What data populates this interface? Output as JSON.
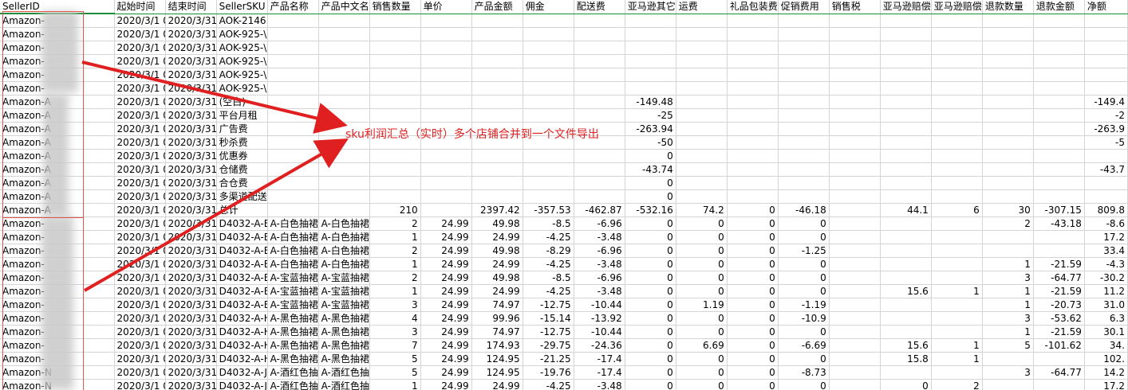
{
  "columns": [
    "SellerID",
    "起始时间",
    "结束时间",
    "SellerSKU",
    "产品名称",
    "产品中文名",
    "销售数量",
    "单价",
    "产品金额",
    "佣金",
    "配送费",
    "亚马逊其它",
    "运费",
    "礼品包装费",
    "促销费用",
    "销售税",
    "亚马逊赔偿",
    "亚马逊赔偿",
    "退款数量",
    "退款金额",
    "净额"
  ],
  "rows": [
    [
      "Amazon-",
      "2020/3/1 0",
      "2020/3/31",
      "AOK-2146",
      "",
      "",
      "",
      "",
      "",
      "",
      "",
      "",
      "",
      "",
      "",
      "",
      "",
      "",
      "",
      "",
      ""
    ],
    [
      "Amazon-",
      "2020/3/1 0",
      "2020/3/31",
      "AOK-925-\\",
      "",
      "",
      "",
      "",
      "",
      "",
      "",
      "",
      "",
      "",
      "",
      "",
      "",
      "",
      "",
      "",
      ""
    ],
    [
      "Amazon-",
      "2020/3/1 0",
      "2020/3/31",
      "AOK-925-\\",
      "",
      "",
      "",
      "",
      "",
      "",
      "",
      "",
      "",
      "",
      "",
      "",
      "",
      "",
      "",
      "",
      ""
    ],
    [
      "Amazon-",
      "2020/3/1 0",
      "2020/3/31",
      "AOK-925-\\",
      "",
      "",
      "",
      "",
      "",
      "",
      "",
      "",
      "",
      "",
      "",
      "",
      "",
      "",
      "",
      "",
      ""
    ],
    [
      "Amazon-",
      "2020/3/1 0",
      "2020/3/31",
      "AOK-925-\\",
      "",
      "",
      "",
      "",
      "",
      "",
      "",
      "",
      "",
      "",
      "",
      "",
      "",
      "",
      "",
      "",
      ""
    ],
    [
      "Amazon-",
      "2020/3/1 0",
      "2020/3/31",
      "AOK-925-\\",
      "",
      "",
      "",
      "",
      "",
      "",
      "",
      "",
      "",
      "",
      "",
      "",
      "",
      "",
      "",
      "",
      ""
    ],
    [
      "Amazon-A",
      "2020/3/1 0",
      "2020/3/31",
      "(空白)",
      "",
      "",
      "",
      "",
      "",
      "",
      "",
      "-149.48",
      "",
      "",
      "",
      "",
      "",
      "",
      "",
      "",
      "-149.4"
    ],
    [
      "Amazon-A",
      "2020/3/1 0",
      "2020/3/31",
      "平台月租",
      "",
      "",
      "",
      "",
      "",
      "",
      "",
      "-25",
      "",
      "",
      "",
      "",
      "",
      "",
      "",
      "",
      "-2"
    ],
    [
      "Amazon-A",
      "2020/3/1 0",
      "2020/3/31",
      "广告费",
      "",
      "",
      "",
      "",
      "",
      "",
      "",
      "-263.94",
      "",
      "",
      "",
      "",
      "",
      "",
      "",
      "",
      "-263.9"
    ],
    [
      "Amazon-A",
      "2020/3/1 0",
      "2020/3/31",
      "秒杀费",
      "",
      "",
      "",
      "",
      "",
      "",
      "",
      "-50",
      "",
      "",
      "",
      "",
      "",
      "",
      "",
      "",
      "-5"
    ],
    [
      "Amazon-A",
      "2020/3/1 0",
      "2020/3/31",
      "优惠券",
      "",
      "",
      "",
      "",
      "",
      "",
      "",
      "0",
      "",
      "",
      "",
      "",
      "",
      "",
      "",
      "",
      ""
    ],
    [
      "Amazon-A",
      "2020/3/1 0",
      "2020/3/31",
      "仓储费",
      "",
      "",
      "",
      "",
      "",
      "",
      "",
      "-43.74",
      "",
      "",
      "",
      "",
      "",
      "",
      "",
      "",
      "-43.7"
    ],
    [
      "Amazon-A",
      "2020/3/1 0",
      "2020/3/31",
      "合仓费",
      "",
      "",
      "",
      "",
      "",
      "",
      "",
      "0",
      "",
      "",
      "",
      "",
      "",
      "",
      "",
      "",
      ""
    ],
    [
      "Amazon-A",
      "2020/3/1 0",
      "2020/3/31",
      "多渠道配送",
      "",
      "",
      "",
      "",
      "",
      "",
      "",
      "0",
      "",
      "",
      "",
      "",
      "",
      "",
      "",
      "",
      ""
    ],
    [
      "Amazon-A",
      "2020/3/1 0",
      "2020/3/31",
      "总计",
      "",
      "",
      "210",
      "",
      "2397.42",
      "-357.53",
      "-462.87",
      "-532.16",
      "74.2",
      "0",
      "-46.18",
      "",
      "44.1",
      "6",
      "30",
      "-307.15",
      "809.8"
    ],
    [
      "Amazon-",
      "2020/3/1 0",
      "2020/3/31",
      "D4032-A-E",
      "A-白色抽裙",
      "A-白色抽裙",
      "2",
      "24.99",
      "49.98",
      "-8.5",
      "-6.96",
      "0",
      "0",
      "0",
      "0",
      "",
      "",
      "",
      "2",
      "-43.18",
      "-8.6"
    ],
    [
      "Amazon-",
      "2020/3/1 0",
      "2020/3/31",
      "D4032-A-E",
      "A-白色抽裙",
      "A-白色抽裙",
      "1",
      "24.99",
      "24.99",
      "-4.25",
      "-3.48",
      "0",
      "0",
      "0",
      "0",
      "",
      "",
      "",
      "",
      "",
      "17.2"
    ],
    [
      "Amazon-",
      "2020/3/1 0",
      "2020/3/31",
      "D4032-A-E",
      "A-白色抽裙",
      "A-白色抽裙",
      "2",
      "24.99",
      "49.98",
      "-8.29",
      "-6.96",
      "0",
      "0",
      "0",
      "-1.25",
      "",
      "",
      "",
      "",
      "",
      "33.4"
    ],
    [
      "Amazon-",
      "2020/3/1 0",
      "2020/3/31",
      "D4032-A-E",
      "A-白色抽裙",
      "A-白色抽裙",
      "1",
      "24.99",
      "24.99",
      "-4.25",
      "-3.48",
      "0",
      "0",
      "0",
      "0",
      "",
      "",
      "",
      "1",
      "-21.59",
      "-4.3"
    ],
    [
      "Amazon-",
      "2020/3/1 0",
      "2020/3/31",
      "D4032-A-E",
      "A-宝蓝抽裙",
      "A-宝蓝抽裙",
      "2",
      "24.99",
      "49.98",
      "-8.5",
      "-6.96",
      "0",
      "0",
      "0",
      "0",
      "",
      "",
      "",
      "3",
      "-64.77",
      "-30.2"
    ],
    [
      "Amazon-",
      "2020/3/1 0",
      "2020/3/31",
      "D4032-A-E",
      "A-宝蓝抽裙",
      "A-宝蓝抽裙",
      "1",
      "24.99",
      "24.99",
      "-4.25",
      "-3.48",
      "0",
      "0",
      "0",
      "0",
      "",
      "15.6",
      "1",
      "1",
      "-21.59",
      "11.2"
    ],
    [
      "Amazon-",
      "2020/3/1 0",
      "2020/3/31",
      "D4032-A-E",
      "A-宝蓝抽裙",
      "A-宝蓝抽裙",
      "3",
      "24.99",
      "74.97",
      "-12.75",
      "-10.44",
      "0",
      "1.19",
      "0",
      "-1.19",
      "",
      "",
      "",
      "1",
      "-20.73",
      "31.0"
    ],
    [
      "Amazon-",
      "2020/3/1 0",
      "2020/3/31",
      "D4032-A-H",
      "A-黑色抽裙",
      "A-黑色抽裙",
      "4",
      "24.99",
      "99.96",
      "-15.14",
      "-13.92",
      "0",
      "0",
      "0",
      "-10.9",
      "",
      "",
      "",
      "3",
      "-53.62",
      "6.3"
    ],
    [
      "Amazon-",
      "2020/3/1 0",
      "2020/3/31",
      "D4032-A-H",
      "A-黑色抽裙",
      "A-黑色抽裙",
      "3",
      "24.99",
      "74.97",
      "-12.75",
      "-10.44",
      "0",
      "0",
      "0",
      "0",
      "",
      "",
      "",
      "1",
      "-21.59",
      "30.1"
    ],
    [
      "Amazon-",
      "2020/3/1 0",
      "2020/3/31",
      "D4032-A-H",
      "A-黑色抽裙",
      "A-黑色抽裙",
      "7",
      "24.99",
      "174.93",
      "-29.75",
      "-24.36",
      "0",
      "6.69",
      "0",
      "-6.69",
      "",
      "15.6",
      "1",
      "5",
      "-101.62",
      "34."
    ],
    [
      "Amazon-",
      "2020/3/1 0",
      "2020/3/31",
      "D4032-A-H",
      "A-黑色抽裙",
      "A-黑色抽裙",
      "5",
      "24.99",
      "124.95",
      "-21.25",
      "-17.4",
      "0",
      "0",
      "0",
      "0",
      "",
      "15.8",
      "1",
      "",
      "",
      "102."
    ],
    [
      "Amazon-N",
      "2020/3/1 0",
      "2020/3/31",
      "D4032-A-J",
      "A-酒红色抽",
      "A-酒红色抽",
      "5",
      "24.99",
      "124.95",
      "-19.76",
      "-17.4",
      "0",
      "0",
      "0",
      "-8.73",
      "",
      "",
      "",
      "3",
      "-64.77",
      "14.2"
    ],
    [
      "Amazon-N",
      "2020/3/1 0",
      "2020/3/31",
      "D4032-A-J",
      "A-酒红色抽",
      "A-酒红色抽",
      "1",
      "24.99",
      "24.99",
      "-4.25",
      "-3.48",
      "0",
      "0",
      "0",
      "0",
      "",
      "0",
      "2",
      "",
      "",
      "17.2"
    ]
  ],
  "annotation": {
    "text": "sku利润汇总（实时）多个店铺合并到一个文件导出",
    "color": "#e02020"
  },
  "colors": {
    "header_border": "#1e8d3b",
    "grid_line": "#d4d4d4",
    "annotation_red": "#e02020"
  }
}
